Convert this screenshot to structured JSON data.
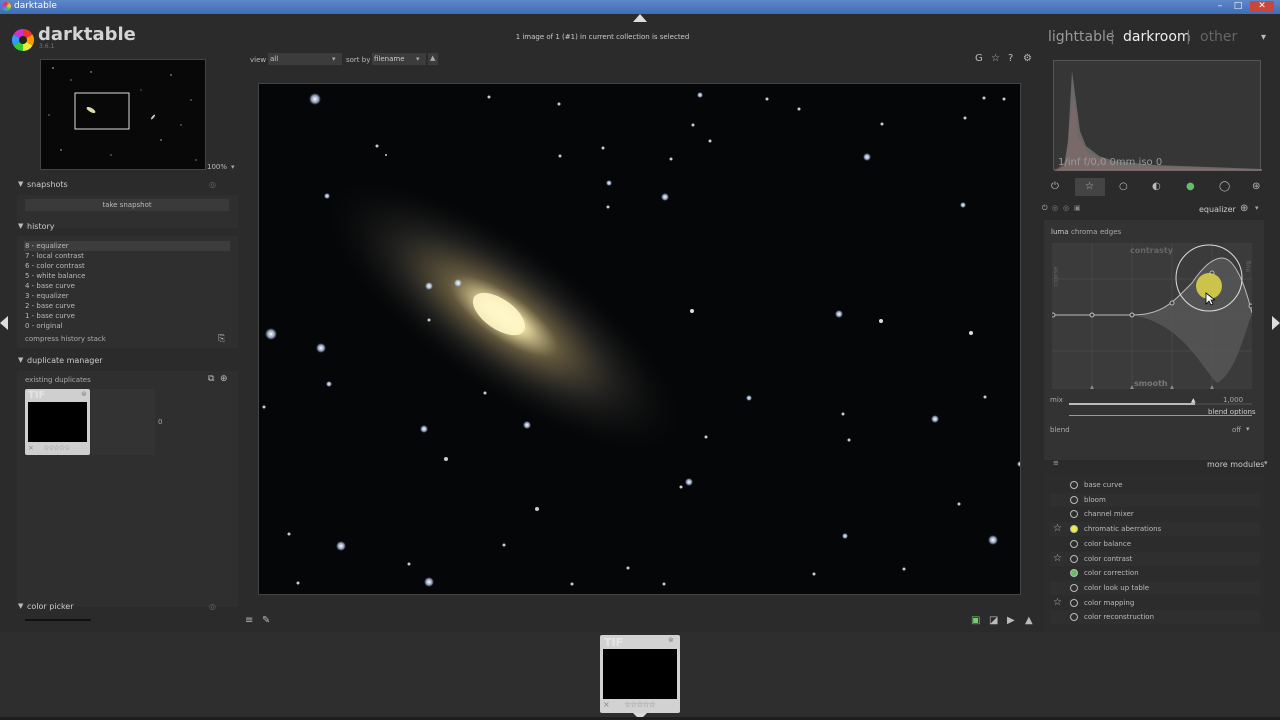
{
  "window": {
    "title": "darktable",
    "minimize": "–",
    "maximize": "□",
    "close": "✕"
  },
  "logo": {
    "name": "darktable",
    "version": "3.6.1"
  },
  "header": {
    "collection_status": "1 image of 1 (#1) in current collection is selected",
    "views": {
      "lighttable": "lighttable",
      "darkroom": "darkroom",
      "other": "other",
      "sep": "|"
    }
  },
  "toolbar": {
    "view_label": "view",
    "view_value": "all",
    "sort_label": "sort by",
    "sort_value": "filename",
    "icons": [
      "G",
      "☆",
      "?",
      "⚙"
    ]
  },
  "navigation": {
    "zoom": "100%"
  },
  "snapshots": {
    "title": "snapshots",
    "take_snapshot": "take snapshot"
  },
  "history": {
    "title": "history",
    "items": [
      "8 - equalizer",
      "7 - local contrast",
      "6 - color contrast",
      "5 - white balance",
      "4 - base curve",
      "3 - equalizer",
      "2 - base curve",
      "1 - base curve",
      "0 - original"
    ],
    "compress": "compress history stack"
  },
  "duplicate_manager": {
    "title": "duplicate manager",
    "existing": "existing duplicates",
    "thumb_label": "TIF",
    "count": "0"
  },
  "color_picker": {
    "title": "color picker"
  },
  "histogram": {
    "exif": "1/inf f/0,0 0mm iso 0"
  },
  "equalizer": {
    "title": "equalizer",
    "tabs": [
      "luma",
      "chroma",
      "edges"
    ],
    "labels": {
      "contrasty": "contrasty",
      "smooth": "smooth",
      "coarse": "coarse",
      "fine": "fine"
    },
    "mix_label": "mix",
    "mix_value": "1,000",
    "blend_options": "blend options",
    "blend_label": "blend",
    "blend_value": "off"
  },
  "modules_header": {
    "more_modules": "more modules"
  },
  "modules": [
    {
      "name": "base curve",
      "fav": false
    },
    {
      "name": "bloom",
      "fav": false
    },
    {
      "name": "channel mixer",
      "fav": false
    },
    {
      "name": "chromatic aberrations",
      "fav": true
    },
    {
      "name": "color balance",
      "fav": false
    },
    {
      "name": "color contrast",
      "fav": true
    },
    {
      "name": "color correction",
      "fav": false
    },
    {
      "name": "color look up table",
      "fav": false
    },
    {
      "name": "color mapping",
      "fav": true
    },
    {
      "name": "color reconstruction",
      "fav": false
    }
  ],
  "filmstrip": {
    "thumb_label": "TIF"
  },
  "colors": {
    "accent": "#d8d04a",
    "bg": "#2b2b2b",
    "panel": "#2f2f2f"
  }
}
